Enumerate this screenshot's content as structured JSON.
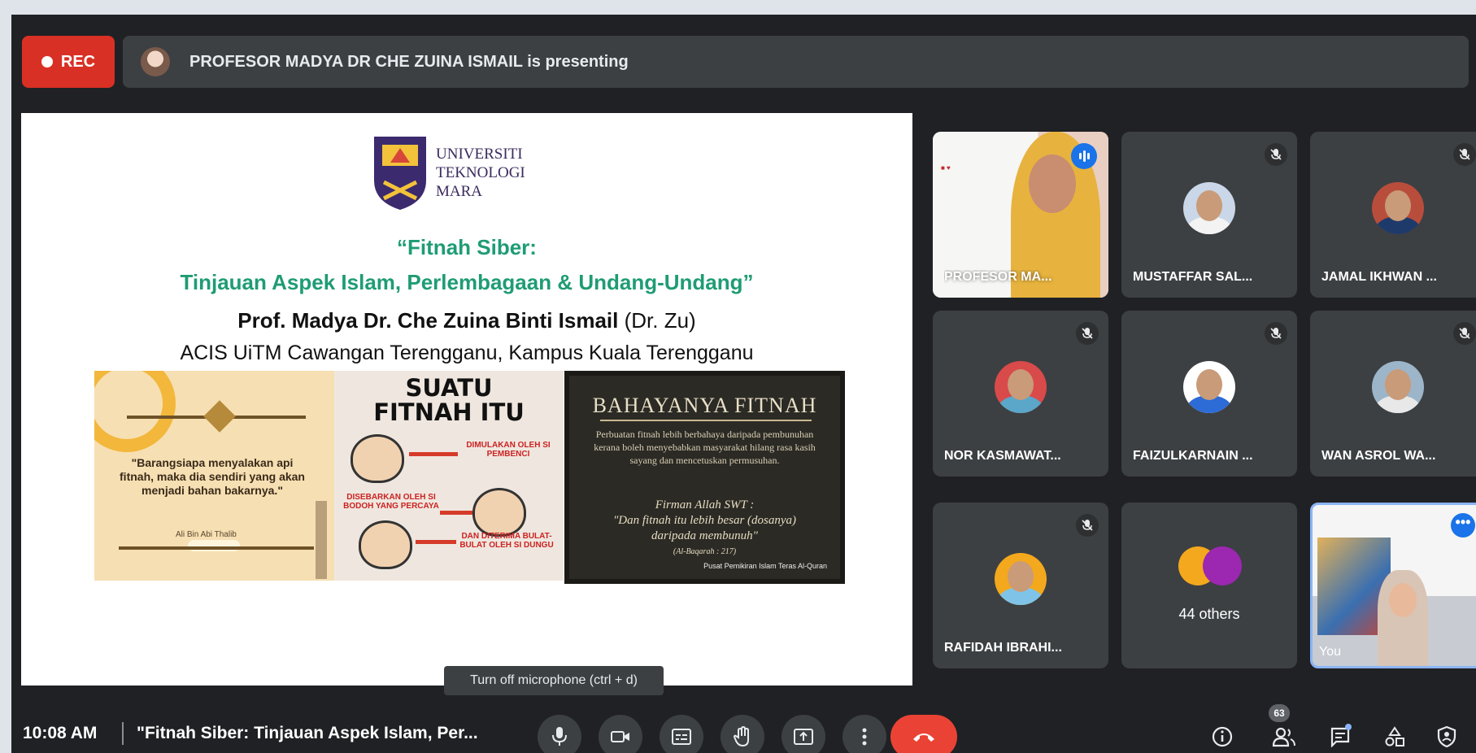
{
  "recording": {
    "label": "REC"
  },
  "presenter_bar": {
    "text": "PROFESOR MADYA DR CHE ZUINA ISMAIL is presenting"
  },
  "slide": {
    "university": {
      "line0": "",
      "line1": "UNIVERSITI",
      "line2": "TEKNOLOGI",
      "line3": "MARA"
    },
    "title_line1": "“Fitnah Siber:",
    "title_line2": "Tinjauan Aspek Islam, Perlembagaan & Undang-Undang”",
    "author_bold": "Prof. Madya Dr. Che Zuina Binti Ismail",
    "author_rest": " (Dr. Zu)",
    "organization": "ACIS UiTM Cawangan Terengganu, Kampus Kuala Terengganu",
    "image1": {
      "quote": "\"Barangsiapa menyalakan api fitnah, maka dia sendiri yang akan menjadi bahan bakarnya.\"",
      "source": "Ali Bin Abi Thalib"
    },
    "image2": {
      "heading_line1": "SUATU",
      "heading_line2": "FITNAH ITU",
      "label1": "DIMULAKAN OLEH SI PEMBENCI",
      "label2": "DISEBARKAN OLEH SI BODOH YANG PERCAYA",
      "label3": "DAN DITERIMA BULAT-BULAT OLEH SI DUNGU"
    },
    "image3": {
      "title": "BAHAYANYA FITNAH",
      "body": "Perbuatan fitnah lebih berbahaya daripada pembunuhan kerana boleh menyebabkan masyarakat hilang rasa kasih sayang dan mencetuskan permusuhan.",
      "firman_label": "Firman Allah SWT :",
      "firman_text": "\"Dan fitnah itu lebih besar (dosanya) daripada membunuh\"",
      "firman_ref": "(Al-Baqarah : 217)",
      "signature": "Pusat Pemikiran Islam Teras Al-Quran"
    }
  },
  "participants": [
    {
      "name": "PROFESOR MA...",
      "muted": false,
      "speaking": true
    },
    {
      "name": "MUSTAFFAR SAL...",
      "muted": true,
      "avatar_bg": "#c9d7e8",
      "shirt": "#f3f3f3"
    },
    {
      "name": "JAMAL IKHWAN ...",
      "muted": true,
      "avatar_bg": "#b94d3c",
      "shirt": "#1e3a6b"
    },
    {
      "name": "NOR KASMAWAT...",
      "muted": true,
      "avatar_bg": "#d94a4a",
      "shirt": "#5aa7c9"
    },
    {
      "name": "FAIZULKARNAIN ...",
      "muted": true,
      "avatar_bg": "#ffffff",
      "shirt": "#2d6bd6"
    },
    {
      "name": "WAN ASROL WA...",
      "muted": true,
      "avatar_bg": "#9db5c9",
      "shirt": "#e8e8e8"
    },
    {
      "name": "RAFIDAH IBRAHI...",
      "muted": true,
      "avatar_bg": "#f4a81d",
      "shirt": "#7fc4e8"
    },
    {
      "name": "44 others"
    },
    {
      "name": "You"
    }
  ],
  "tooltip": "Turn off microphone (ctrl + d)",
  "bottom_bar": {
    "time": "10:08 AM",
    "meeting_title": "\"Fitnah Siber: Tinjauan Aspek Islam, Per...",
    "people_count": "63"
  },
  "colors": {
    "rec": "#d93025",
    "hangup": "#ea4335",
    "accent": "#1a73e8",
    "slide_title": "#1f9c74"
  },
  "icons": [
    "mic-icon",
    "camera-icon",
    "captions-icon",
    "raise-hand-icon",
    "present-icon",
    "more-options-icon",
    "hang-up-icon",
    "info-icon",
    "people-icon",
    "chat-icon",
    "activities-icon",
    "host-controls-icon"
  ]
}
